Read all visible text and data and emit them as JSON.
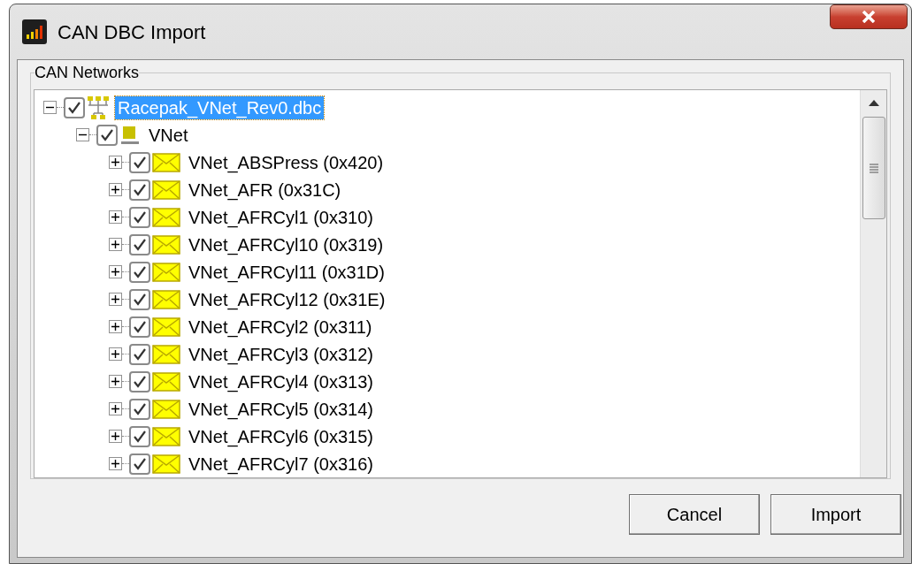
{
  "window": {
    "title": "CAN DBC Import"
  },
  "group": {
    "title": "CAN Networks"
  },
  "tree": [
    {
      "kind": "file",
      "label": "Racepak_VNet_Rev0.dbc",
      "expanded": true,
      "checked": true,
      "selected": true,
      "children": [
        {
          "kind": "network",
          "label": "VNet",
          "expanded": true,
          "checked": true,
          "selected": false,
          "children": [
            {
              "kind": "message",
              "label": "VNet_ABSPress (0x420)",
              "expanded": false,
              "checked": true,
              "selected": false
            },
            {
              "kind": "message",
              "label": "VNet_AFR (0x31C)",
              "expanded": false,
              "checked": true,
              "selected": false
            },
            {
              "kind": "message",
              "label": "VNet_AFRCyl1 (0x310)",
              "expanded": false,
              "checked": true,
              "selected": false
            },
            {
              "kind": "message",
              "label": "VNet_AFRCyl10 (0x319)",
              "expanded": false,
              "checked": true,
              "selected": false
            },
            {
              "kind": "message",
              "label": "VNet_AFRCyl11 (0x31D)",
              "expanded": false,
              "checked": true,
              "selected": false
            },
            {
              "kind": "message",
              "label": "VNet_AFRCyl12 (0x31E)",
              "expanded": false,
              "checked": true,
              "selected": false
            },
            {
              "kind": "message",
              "label": "VNet_AFRCyl2 (0x311)",
              "expanded": false,
              "checked": true,
              "selected": false
            },
            {
              "kind": "message",
              "label": "VNet_AFRCyl3 (0x312)",
              "expanded": false,
              "checked": true,
              "selected": false
            },
            {
              "kind": "message",
              "label": "VNet_AFRCyl4 (0x313)",
              "expanded": false,
              "checked": true,
              "selected": false
            },
            {
              "kind": "message",
              "label": "VNet_AFRCyl5 (0x314)",
              "expanded": false,
              "checked": true,
              "selected": false
            },
            {
              "kind": "message",
              "label": "VNet_AFRCyl6 (0x315)",
              "expanded": false,
              "checked": true,
              "selected": false
            },
            {
              "kind": "message",
              "label": "VNet_AFRCyl7 (0x316)",
              "expanded": false,
              "checked": true,
              "selected": false
            }
          ]
        }
      ]
    }
  ],
  "buttons": [
    {
      "label": "Cancel"
    },
    {
      "label": "Import"
    }
  ]
}
